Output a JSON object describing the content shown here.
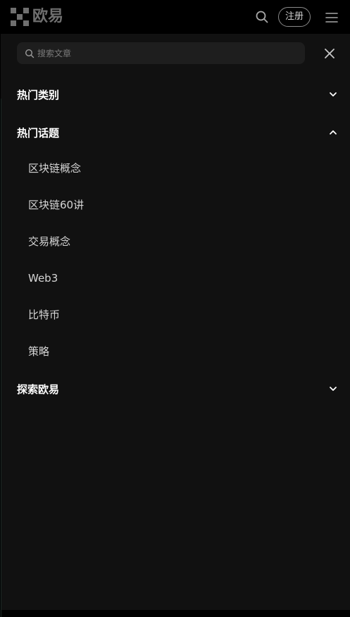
{
  "header": {
    "logo_text": "欧易",
    "register_label": "注册",
    "icons": {
      "logo": "okx-logo-mark",
      "search": "search-icon",
      "menu": "hamburger-menu-icon"
    }
  },
  "menu": {
    "search": {
      "placeholder": "搜索文章",
      "value": ""
    },
    "close_icon": "close-icon",
    "sections": [
      {
        "title": "热门类别",
        "expanded": false,
        "items": []
      },
      {
        "title": "热门话题",
        "expanded": true,
        "items": [
          {
            "label": "区块链概念"
          },
          {
            "label": "区块链60讲"
          },
          {
            "label": "交易概念"
          },
          {
            "label": "Web3"
          },
          {
            "label": "比特币"
          },
          {
            "label": "策略"
          }
        ]
      },
      {
        "title": "探索欧易",
        "expanded": false,
        "items": []
      }
    ]
  },
  "colors": {
    "page_bg": "#000000",
    "panel_bg": "#111111",
    "search_bg": "#1e1e1e",
    "logo_text": "#6f6f6f",
    "sub_item_text": "#d6d6d6"
  }
}
